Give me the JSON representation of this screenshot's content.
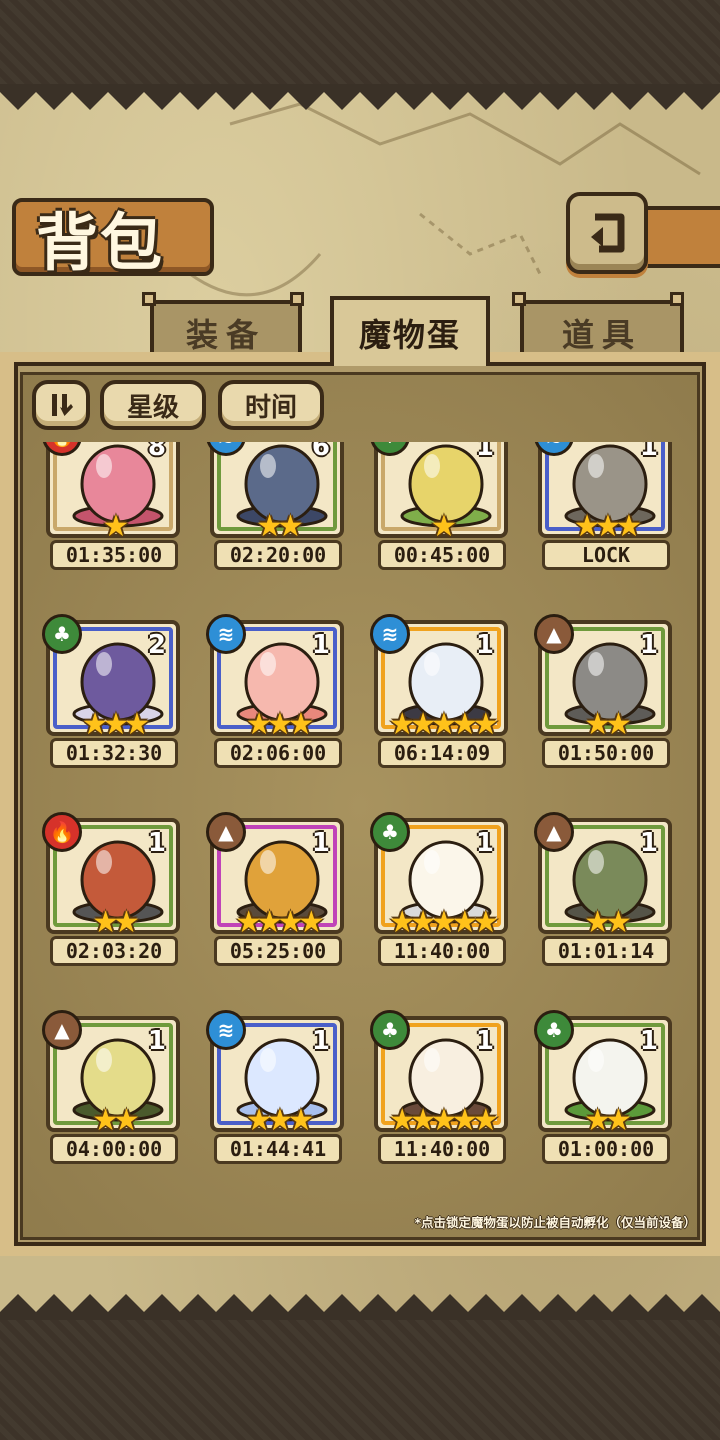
{
  "header": {
    "title": "背包"
  },
  "tabs": [
    {
      "label": "装备",
      "active": false
    },
    {
      "label": "魔物蛋",
      "active": true
    },
    {
      "label": "道具",
      "active": false
    }
  ],
  "sort_buttons": [
    {
      "label": "",
      "icon": "sort-toggle-icon"
    },
    {
      "label": "星级"
    },
    {
      "label": "时间"
    }
  ],
  "eggs": [
    {
      "count": "8",
      "stars": 1,
      "time": "01:35:00",
      "element": "fire",
      "rarity": "normal",
      "art": "slime-egg"
    },
    {
      "count": "6",
      "stars": 2,
      "time": "02:20:00",
      "element": "water",
      "rarity": "uncommon",
      "art": "shell-egg"
    },
    {
      "count": "1",
      "stars": 1,
      "time": "00:45:00",
      "element": "grass",
      "rarity": "normal",
      "art": "leaf-egg"
    },
    {
      "count": "1",
      "stars": 3,
      "time": "LOCK",
      "element": "water",
      "rarity": "rare",
      "art": "stone-egg"
    },
    {
      "count": "2",
      "stars": 3,
      "time": "01:32:30",
      "element": "grass",
      "rarity": "rare",
      "art": "striped-egg"
    },
    {
      "count": "1",
      "stars": 3,
      "time": "02:06:00",
      "element": "water",
      "rarity": "rare",
      "art": "peach-egg"
    },
    {
      "count": "1",
      "stars": 5,
      "time": "06:14:09",
      "element": "water",
      "rarity": "legendary",
      "art": "armored-egg"
    },
    {
      "count": "1",
      "stars": 2,
      "time": "01:50:00",
      "element": "earth",
      "rarity": "uncommon",
      "art": "fur-egg"
    },
    {
      "count": "1",
      "stars": 2,
      "time": "02:03:20",
      "element": "fire",
      "rarity": "uncommon",
      "art": "lava-egg"
    },
    {
      "count": "1",
      "stars": 4,
      "time": "05:25:00",
      "element": "earth",
      "rarity": "epic",
      "art": "horned-egg"
    },
    {
      "count": "1",
      "stars": 5,
      "time": "11:40:00",
      "element": "grass",
      "rarity": "legendary",
      "art": "angel-egg"
    },
    {
      "count": "1",
      "stars": 2,
      "time": "01:01:14",
      "element": "earth",
      "rarity": "uncommon",
      "art": "seed-egg"
    },
    {
      "count": "1",
      "stars": 2,
      "time": "04:00:00",
      "element": "earth",
      "rarity": "uncommon",
      "art": "swamp-egg"
    },
    {
      "count": "1",
      "stars": 3,
      "time": "01:44:41",
      "element": "water",
      "rarity": "rare",
      "art": "cloud-egg"
    },
    {
      "count": "1",
      "stars": 5,
      "time": "11:40:00",
      "element": "grass",
      "rarity": "legendary",
      "art": "thorn-egg"
    },
    {
      "count": "1",
      "stars": 2,
      "time": "01:00:00",
      "element": "grass",
      "rarity": "uncommon",
      "art": "turnip-egg"
    }
  ],
  "hint": "*点击锁定魔物蛋以防止被自动孵化（仅当前设备）",
  "colors": {
    "rarity_normal": "#c9a86a",
    "rarity_uncommon": "#6f9a3c",
    "rarity_rare": "#4a5fc9",
    "rarity_epic": "#c043b8",
    "rarity_legendary": "#f0a21e",
    "element_fire": "#d6322a",
    "element_water": "#2e8fd6",
    "element_grass": "#3e8a3a",
    "element_earth": "#8a5a3a"
  }
}
